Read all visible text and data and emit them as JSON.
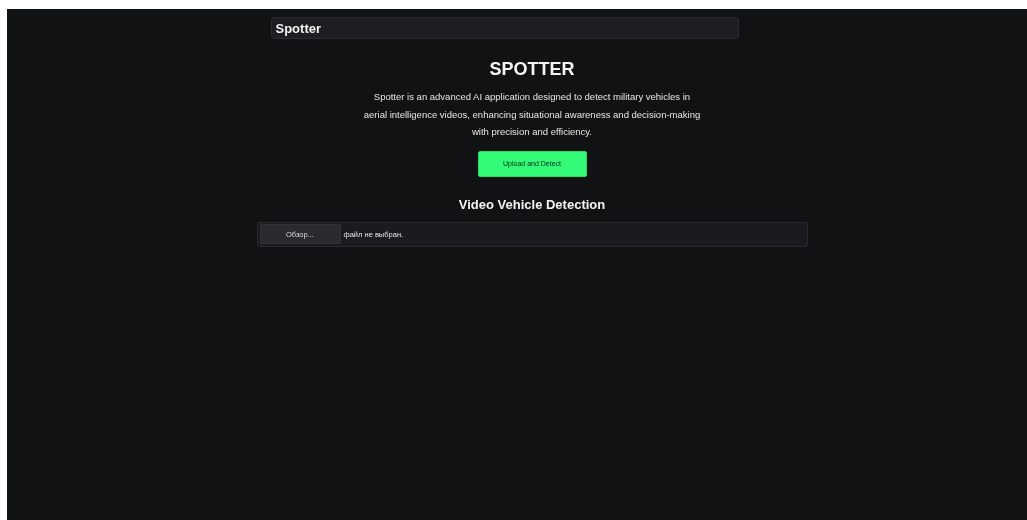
{
  "header": {
    "title": "Spotter"
  },
  "hero": {
    "title": "SPOTTER",
    "description": "Spotter is an advanced AI application designed to detect military vehicles in aerial intelligence videos, enhancing situational awareness and decision-making with precision and efficiency.",
    "button": "Upload and Detect"
  },
  "section": {
    "title": "Video Vehicle Detection",
    "browse_button": "Обзор...",
    "file_status": "файл не выбран."
  }
}
